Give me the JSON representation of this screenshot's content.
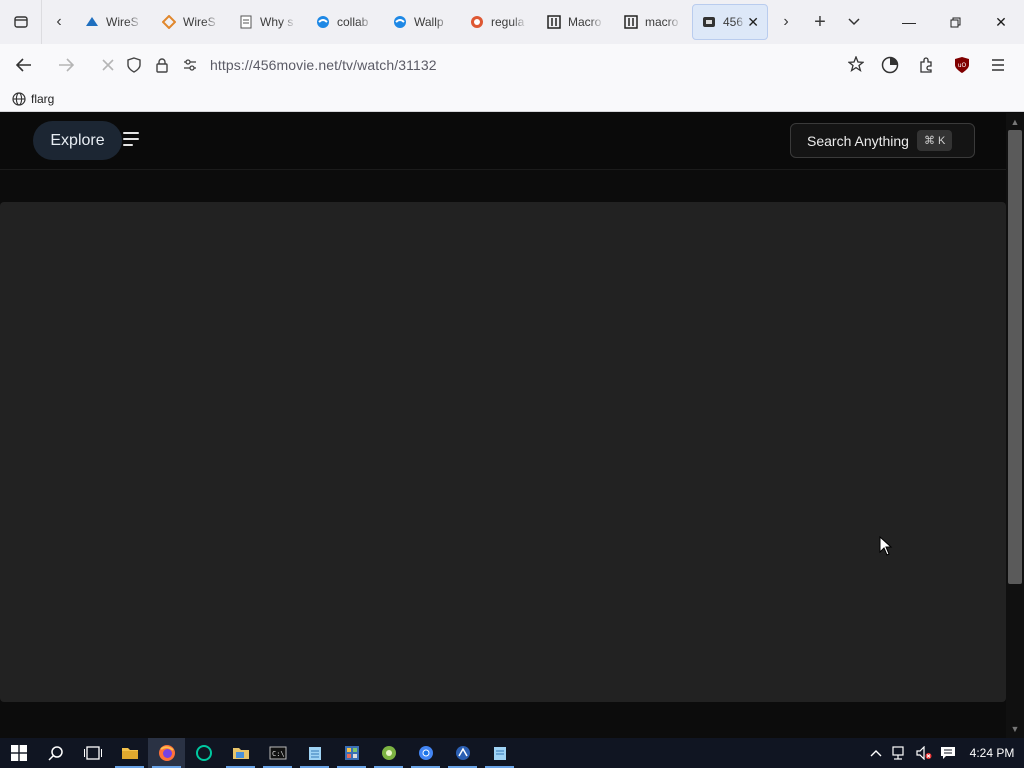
{
  "browser": {
    "tabs": [
      {
        "title": "WireS",
        "icon": "shark-fin-icon"
      },
      {
        "title": "WireS",
        "icon": "diamond-icon"
      },
      {
        "title": "Why s",
        "icon": "document-icon"
      },
      {
        "title": "collab",
        "icon": "wave-icon"
      },
      {
        "title": "Wallp",
        "icon": "wave-icon"
      },
      {
        "title": "regula",
        "icon": "duck-icon"
      },
      {
        "title": "Macro",
        "icon": "columns-icon"
      },
      {
        "title": "macro",
        "icon": "columns-icon"
      },
      {
        "title": "456",
        "icon": "film-icon",
        "active": true
      }
    ],
    "url": "https://456movie.net/tv/watch/31132",
    "bookmarks": [
      {
        "label": "flarg",
        "icon": "globe-icon"
      }
    ]
  },
  "site": {
    "explore_label": "Explore",
    "search_label": "Search Anything",
    "search_shortcut": "⌘ K"
  },
  "taskbar": {
    "apps": [
      "start",
      "search",
      "task-view",
      "file-explorer",
      "firefox",
      "terminal",
      "folder",
      "cmd",
      "notepad",
      "control-panel",
      "app-green",
      "chrome",
      "app-blue",
      "notepad2"
    ],
    "clock": "4:24 PM"
  },
  "colors": {
    "page_bg": "#0c0c0c",
    "player_bg": "#222222",
    "explore_pill": "#1c2633",
    "active_tab": "#dde8f8"
  }
}
